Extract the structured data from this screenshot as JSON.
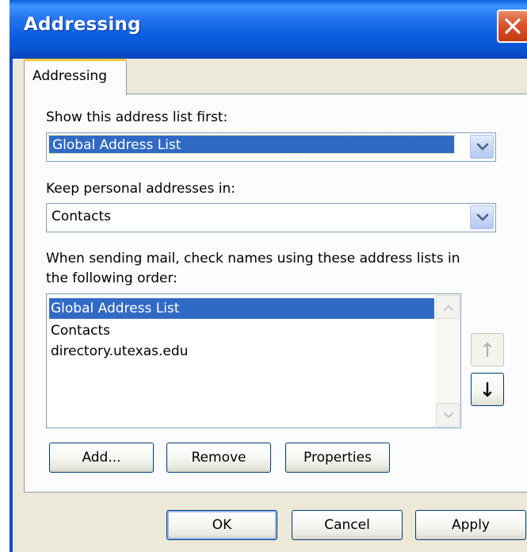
{
  "window": {
    "title": "Addressing",
    "close_icon": "close-icon"
  },
  "tabs": [
    {
      "label": "Addressing",
      "active": true
    }
  ],
  "show_first": {
    "label": "Show this address list first:",
    "value": "Global Address List"
  },
  "keep_personal": {
    "label": "Keep personal addresses in:",
    "value": "Contacts"
  },
  "check_names": {
    "label_line1": "When sending mail, check names using these address lists in",
    "label_line2": "the following order:",
    "items": [
      {
        "label": "Global Address List",
        "selected": true
      },
      {
        "label": "Contacts",
        "selected": false
      },
      {
        "label": "directory.utexas.edu",
        "selected": false
      }
    ],
    "move_up_icon": "arrow-up-icon",
    "move_down_icon": "arrow-down-icon"
  },
  "list_buttons": {
    "add": "Add...",
    "remove": "Remove",
    "properties": "Properties"
  },
  "dialog_buttons": {
    "ok": "OK",
    "cancel": "Cancel",
    "apply": "Apply"
  },
  "colors": {
    "titlebar": "#0a5fd8",
    "selection": "#316ac5",
    "tab_highlight": "#ffc83c",
    "close_button": "#d9532c"
  }
}
